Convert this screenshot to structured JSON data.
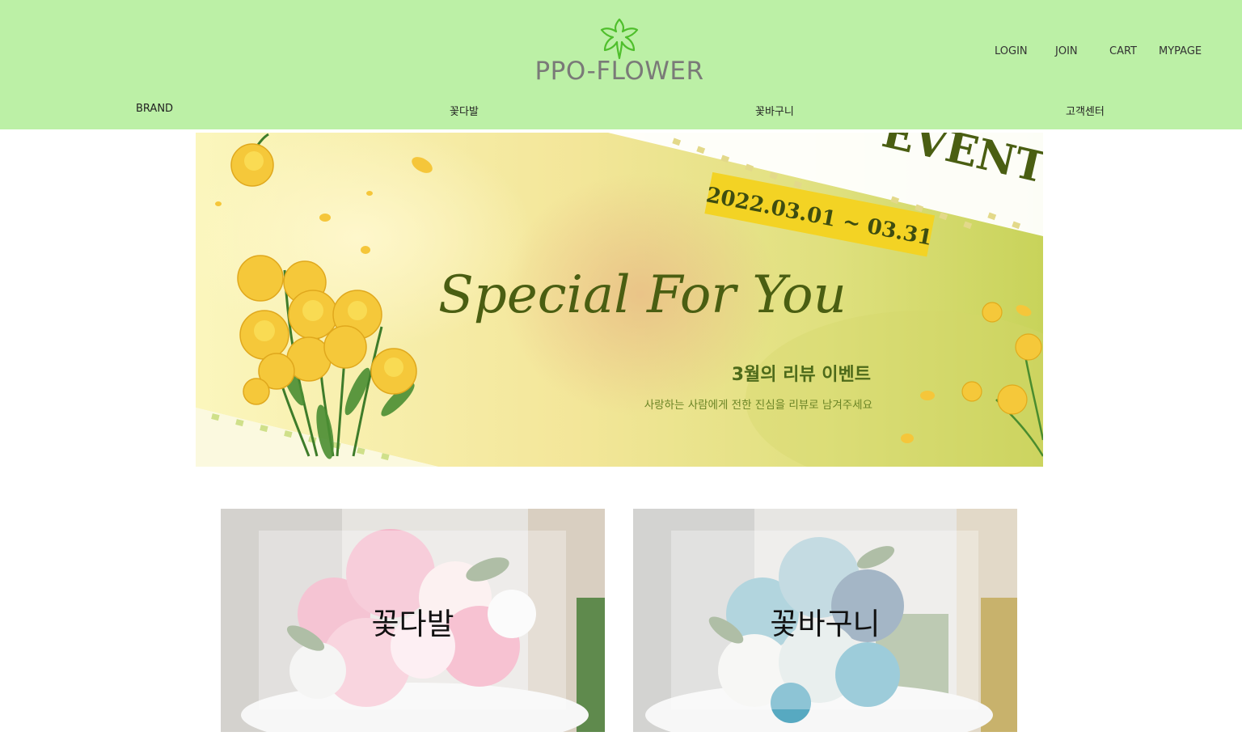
{
  "brand": {
    "logo_text": "PPO-FLOWER"
  },
  "header": {
    "util_links": [
      "LOGIN",
      "JOIN",
      "CART",
      "MYPAGE"
    ],
    "nav": [
      "BRAND",
      "꽃다발",
      "꽃바구니",
      "고객센터"
    ]
  },
  "banner": {
    "event": "EVENT",
    "date": "2022.03.01 ~ 03.31",
    "headline": "Special For You",
    "title": "3월의 리뷰 이벤트",
    "subtitle": "사랑하는 사람에게 전한 진심을 리뷰로 남겨주세요"
  },
  "cards": [
    {
      "label": "꽃다발"
    },
    {
      "label": "꽃바구니"
    }
  ],
  "colors": {
    "header_bg": "#bcf0a6",
    "logo_text": "#7a7a78",
    "banner_green": "#4a5e12",
    "banner_yellow_tag": "#f3d324"
  },
  "icons": {
    "logo_mark": "flower-outline-icon"
  }
}
